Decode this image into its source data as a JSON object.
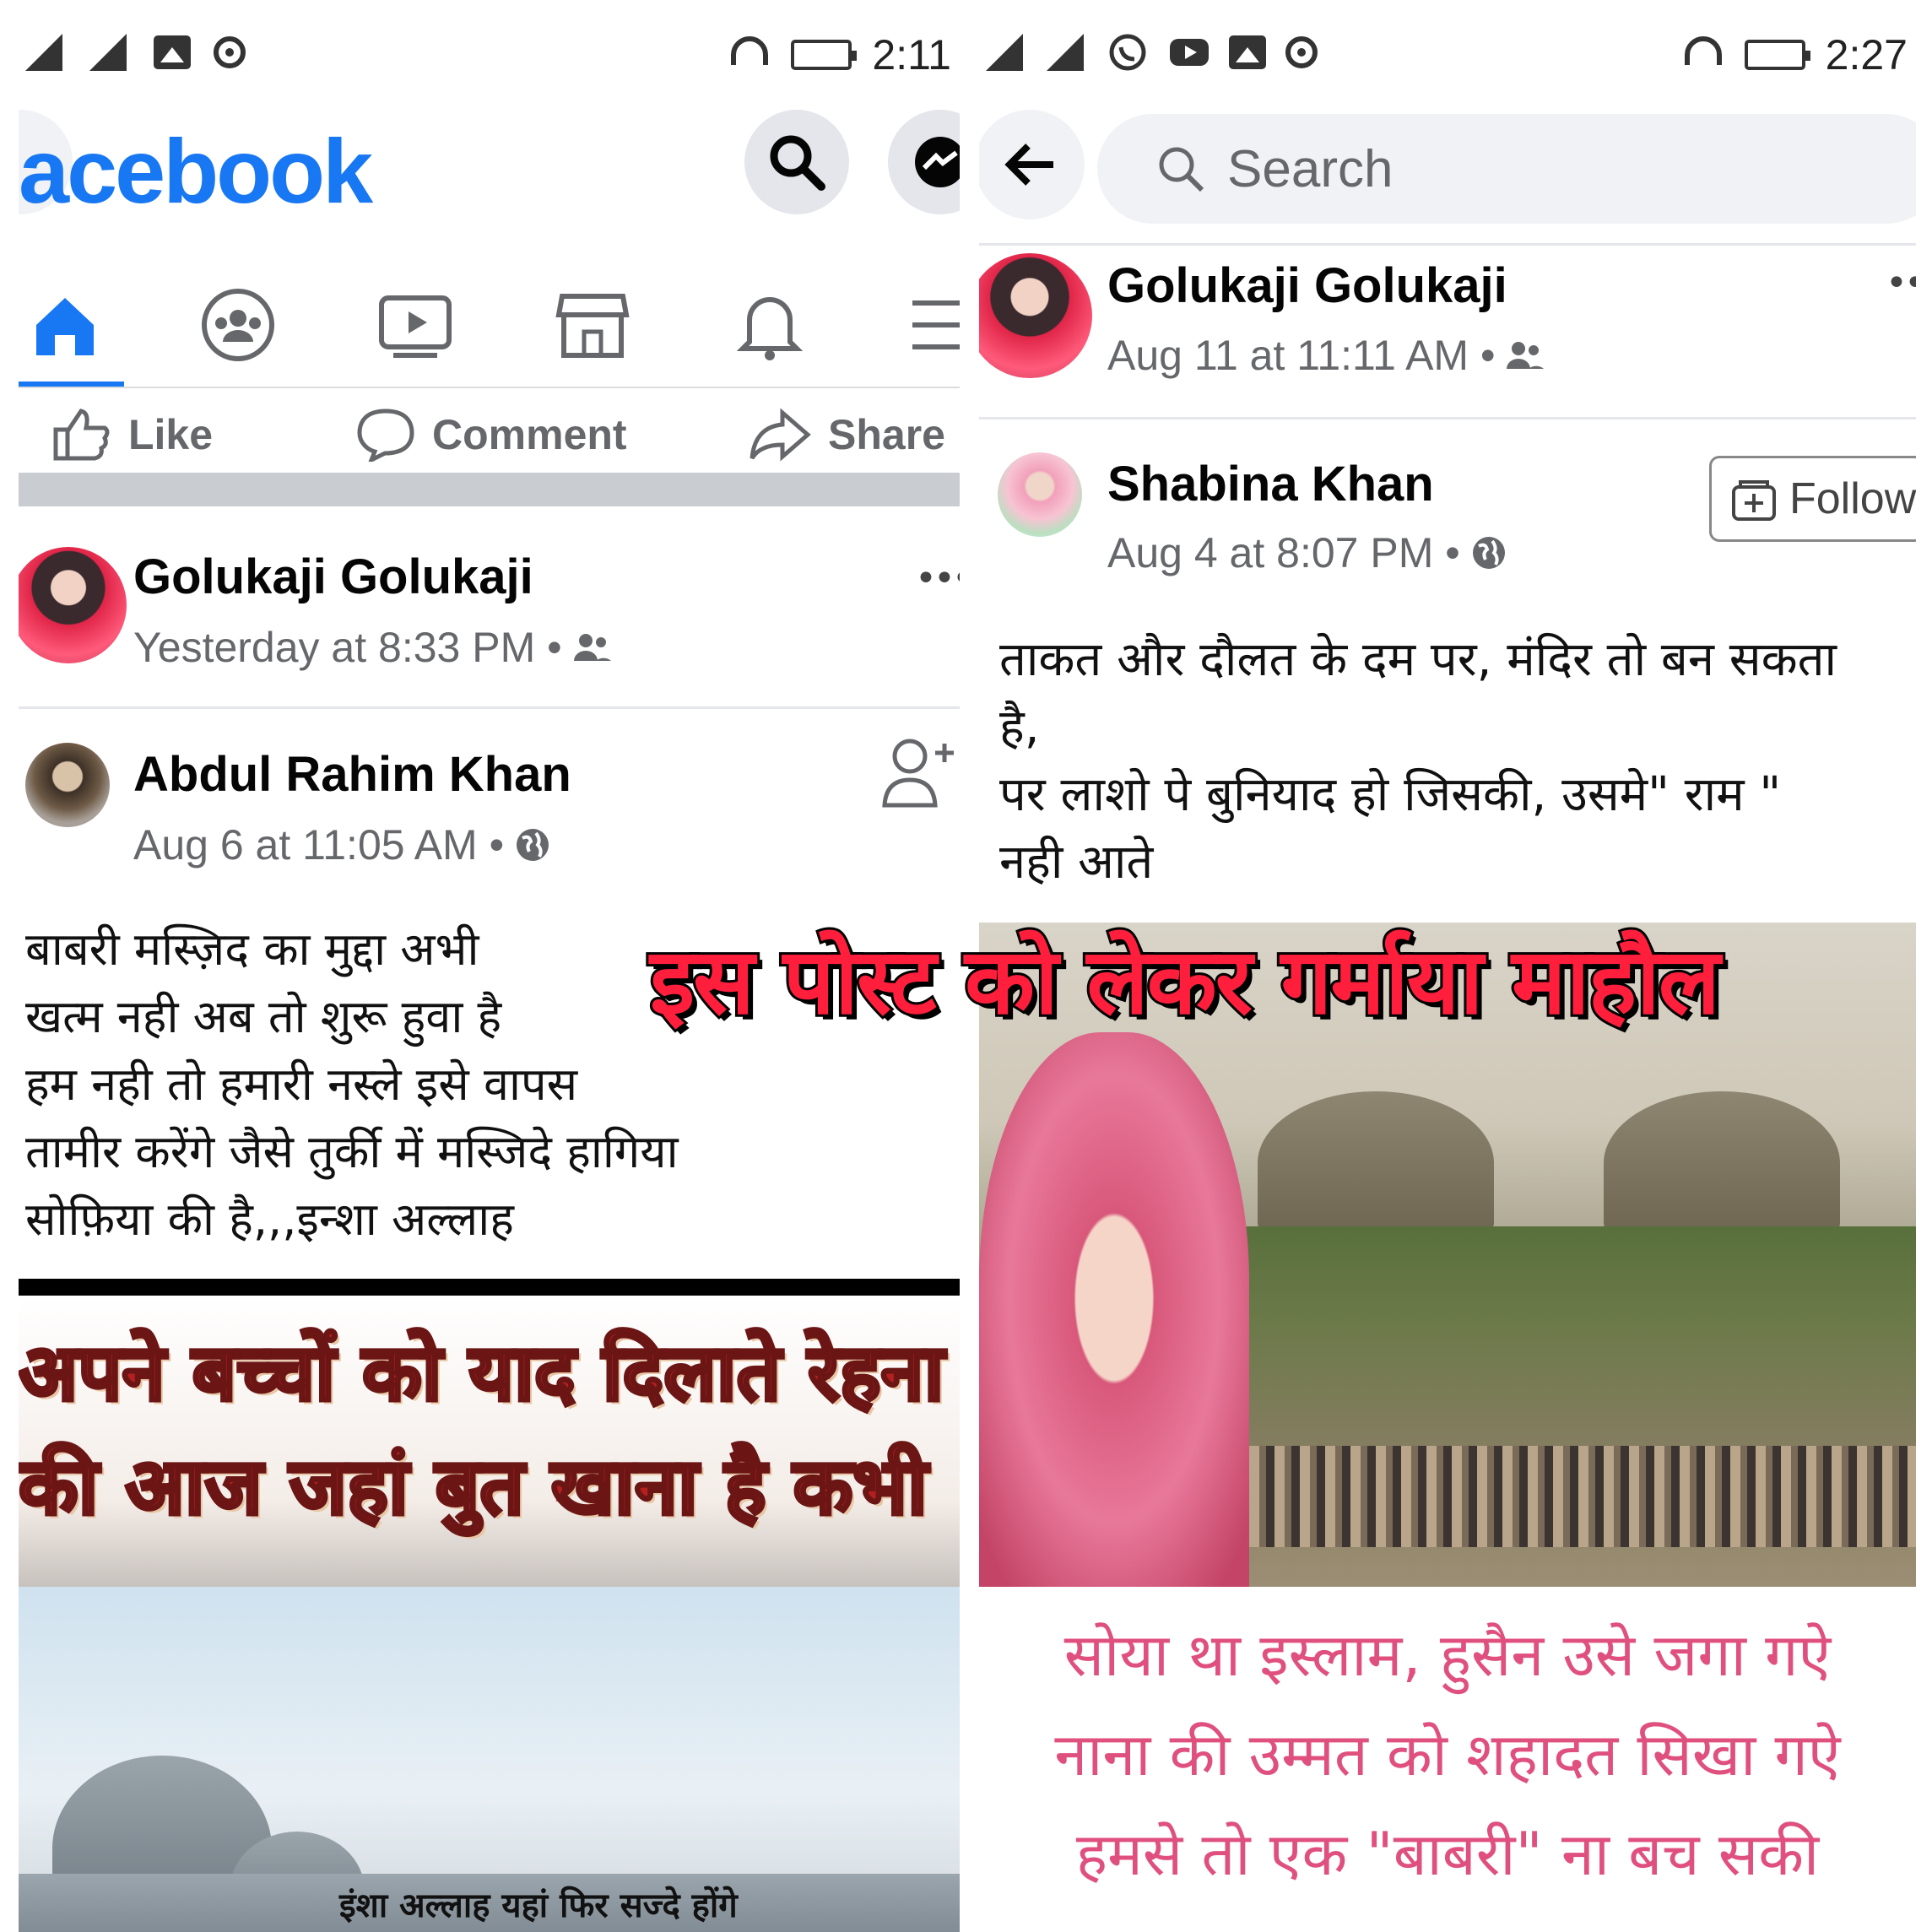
{
  "overlay": {
    "headline": "इस पोस्ट को लेकर गर्माया माहौल"
  },
  "left": {
    "status": {
      "time": "2:11"
    },
    "app": {
      "logo_text": "acebook"
    },
    "actions": {
      "like": "Like",
      "comment": "Comment",
      "share": "Share"
    },
    "post1": {
      "name": "Golukaji Golukaji",
      "meta": "Yesterday at 8:33 PM •"
    },
    "post2": {
      "name": "Abdul Rahim Khan",
      "meta": "Aug 6 at 11:05 AM •",
      "lines": [
        "बाबरी मस्ज़िद का मुद्दा अभी",
        "खत्म नही अब तो शुरू हुवा है",
        "हम नही तो हमारी नस्ले इसे वापस",
        "तामीर करेंगे जैसे तुर्की में मस्जिदे हागिया",
        "सोफ़िया की है,,,इन्शा अल्लाह"
      ],
      "banner": [
        "अपने बच्चों को याद दिलाते रेहना",
        "की आज जहां बुत खाना है कभी"
      ],
      "caption": "इंशा अल्लाह यहां फिर सज्दे होंगे"
    }
  },
  "right": {
    "status": {
      "time": "2:27"
    },
    "search": {
      "placeholder": "Search"
    },
    "post1": {
      "name": "Golukaji Golukaji",
      "meta": "Aug 11 at 11:11 AM •"
    },
    "post2": {
      "name": "Shabina Khan",
      "meta": "Aug 4 at 8:07 PM •",
      "follow": "Follow",
      "lines": [
        "ताकत और दौलत के दम पर, मंदिर तो बन सकता",
        "है,",
        "पर लाशो पे बुनियाद हो जिसकी, उसमे\" राम \"",
        "नही आते"
      ],
      "poem": [
        "सोया था इस्लाम, हुसैन उसे जगा गऐ",
        "नाना की उम्मत को शहादत सिखा गऐ",
        "हमसे तो एक \"बाबरी\" ना बच सकी"
      ]
    }
  },
  "colors": {
    "brand": "#1877f2",
    "headline": "#ff1f3d",
    "poem": "#e0507f"
  }
}
